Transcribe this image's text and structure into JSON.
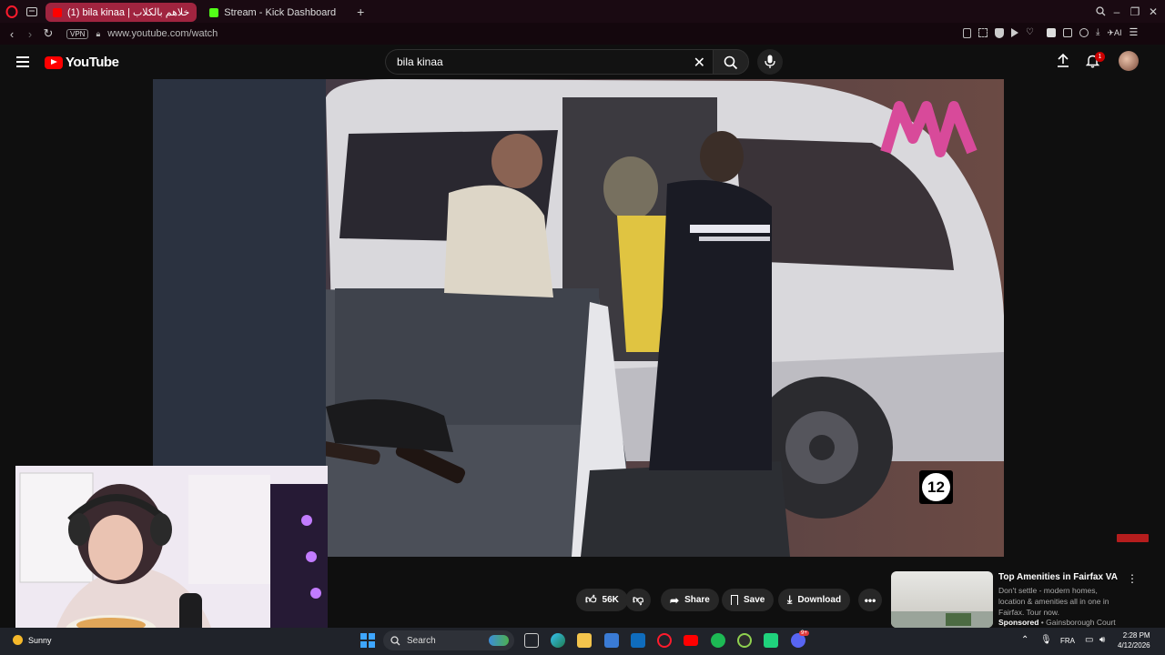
{
  "browser": {
    "tabs": [
      {
        "label": "(1) bila kinaa | خلاهم بالكلاب",
        "active": true
      },
      {
        "label": "Stream - Kick Dashboard",
        "active": false
      }
    ],
    "url": "www.youtube.com/watch",
    "vpn_label": "VPN",
    "ai_label": "AI"
  },
  "youtube": {
    "logo_text": "YouTube",
    "search_value": "bila kinaa",
    "notification_count": "1"
  },
  "video": {
    "rating": "12",
    "channel_watermark": "M"
  },
  "actions": {
    "likes": "56K",
    "share": "Share",
    "save": "Save",
    "download": "Download"
  },
  "ad": {
    "title": "Top Amenities in Fairfax VA",
    "description": "Don't settle - modern homes, location & amenities all in one in Fairfax. Tour now.",
    "sponsored": "Sponsored",
    "advertiser": "Gainsborough Court"
  },
  "taskbar": {
    "weather": "Sunny",
    "search_placeholder": "Search",
    "language": "FRA",
    "time": "2:28 PM",
    "date": "4/12/2026",
    "discord_badge": "9+"
  },
  "colors": {
    "youtube_red": "#ff0000",
    "opera_tab": "#a0243f",
    "taskbar": "#20232a"
  }
}
